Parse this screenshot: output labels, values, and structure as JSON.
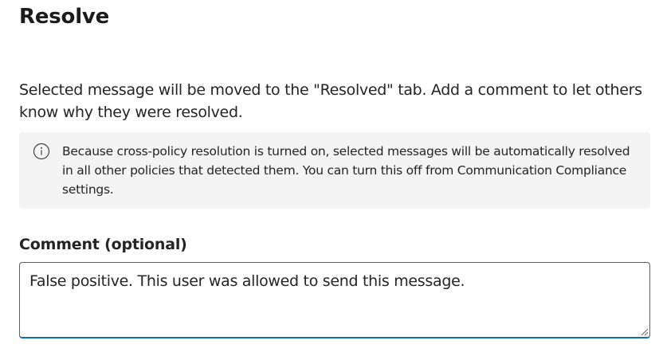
{
  "dialog": {
    "title": "Resolve",
    "description": "Selected message will be moved to the \"Resolved\" tab. Add a comment to let others know why they were resolved.",
    "info_message": "Because cross-policy resolution is turned on, selected messages will be automatically resolved in all other policies that detected them. You can turn this off from Communication Compliance settings.",
    "info_icon": "info-icon"
  },
  "comment": {
    "label": "Comment (optional)",
    "value": "False positive. This user was allowed to send this message."
  },
  "colors": {
    "input_focus_border": "#0f6cbd",
    "info_bar_background": "#f4f4f4",
    "text": "#242424"
  }
}
